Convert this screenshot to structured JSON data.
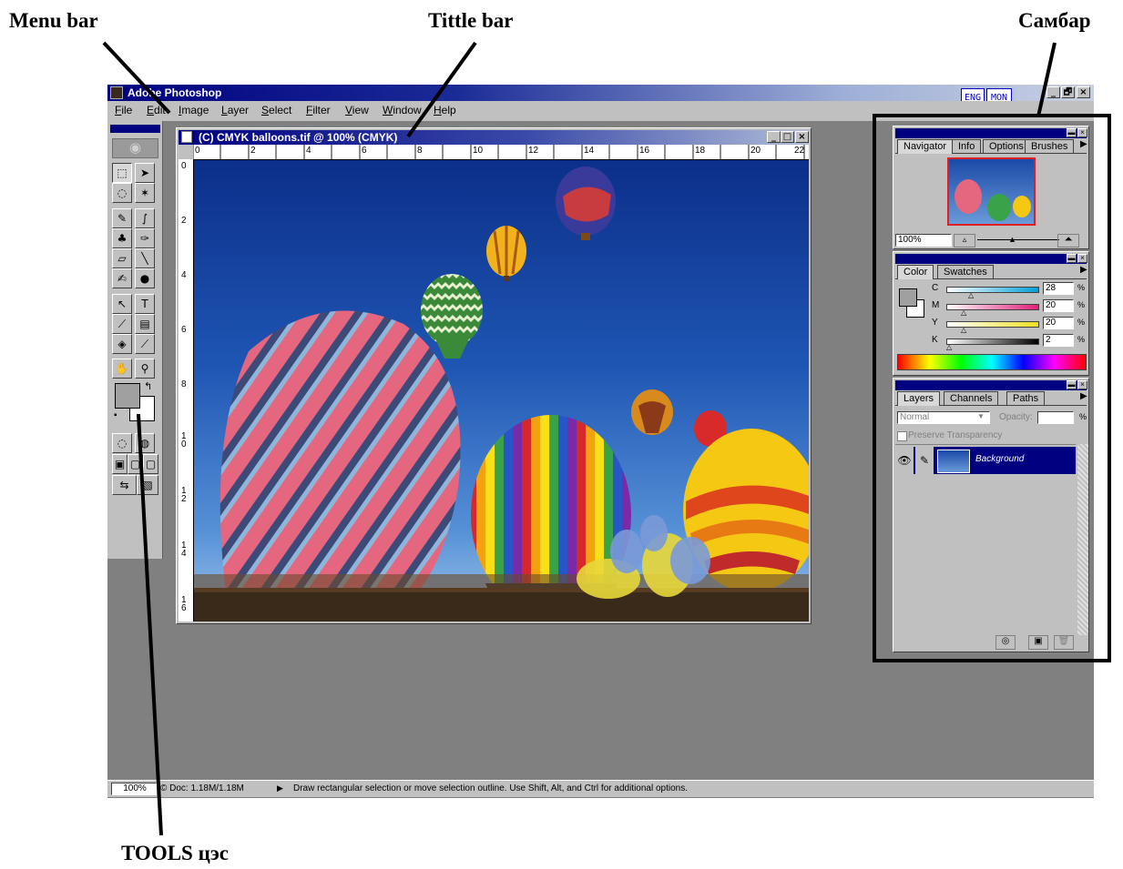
{
  "annotations": {
    "menu_bar": "Menu bar",
    "title_bar": "Tittle bar",
    "sambar": "Самбар",
    "tools": "TOOLS цэс"
  },
  "window": {
    "title": "Adobe Photoshop",
    "ime": [
      "ENG",
      "MON"
    ],
    "controls": [
      "_",
      "🗗",
      "×"
    ]
  },
  "menu": [
    "File",
    "Edit",
    "Image",
    "Layer",
    "Select",
    "Filter",
    "View",
    "Window",
    "Help"
  ],
  "document": {
    "title": "(C) CMYK balloons.tif @ 100% (CMYK)",
    "ruler_top": [
      "0",
      "2",
      "4",
      "6",
      "8",
      "10",
      "12",
      "14",
      "16",
      "18",
      "20",
      "22"
    ],
    "ruler_left": [
      "0",
      "2",
      "4",
      "6",
      "8",
      "1\n0",
      "1\n2",
      "1\n4",
      "1\n6"
    ]
  },
  "navigator": {
    "tabs": [
      "Navigator",
      "Info",
      "Options",
      "Brushes"
    ],
    "zoom": "100%"
  },
  "color": {
    "tabs": [
      "Color",
      "Swatches"
    ],
    "channels": [
      {
        "label": "C",
        "value": "28",
        "unit": "%"
      },
      {
        "label": "M",
        "value": "20",
        "unit": "%"
      },
      {
        "label": "Y",
        "value": "20",
        "unit": "%"
      },
      {
        "label": "K",
        "value": "2",
        "unit": "%"
      }
    ]
  },
  "layers": {
    "tabs": [
      "Layers",
      "Channels",
      "Paths"
    ],
    "blend_mode": "Normal",
    "opacity_label": "Opacity:",
    "opacity_unit": "%",
    "preserve": "Preserve Transparency",
    "layer_name": "Background"
  },
  "status": {
    "zoom": "100%",
    "doc": "© Doc: 1.18M/1.18M",
    "hint": "Draw rectangular selection or move selection outline.  Use Shift, Alt, and Ctrl for additional options."
  },
  "colors": {
    "title_blue": "#000080",
    "face": "#c0c0c0",
    "workspace": "#808080",
    "sky": "#1f56b4"
  }
}
